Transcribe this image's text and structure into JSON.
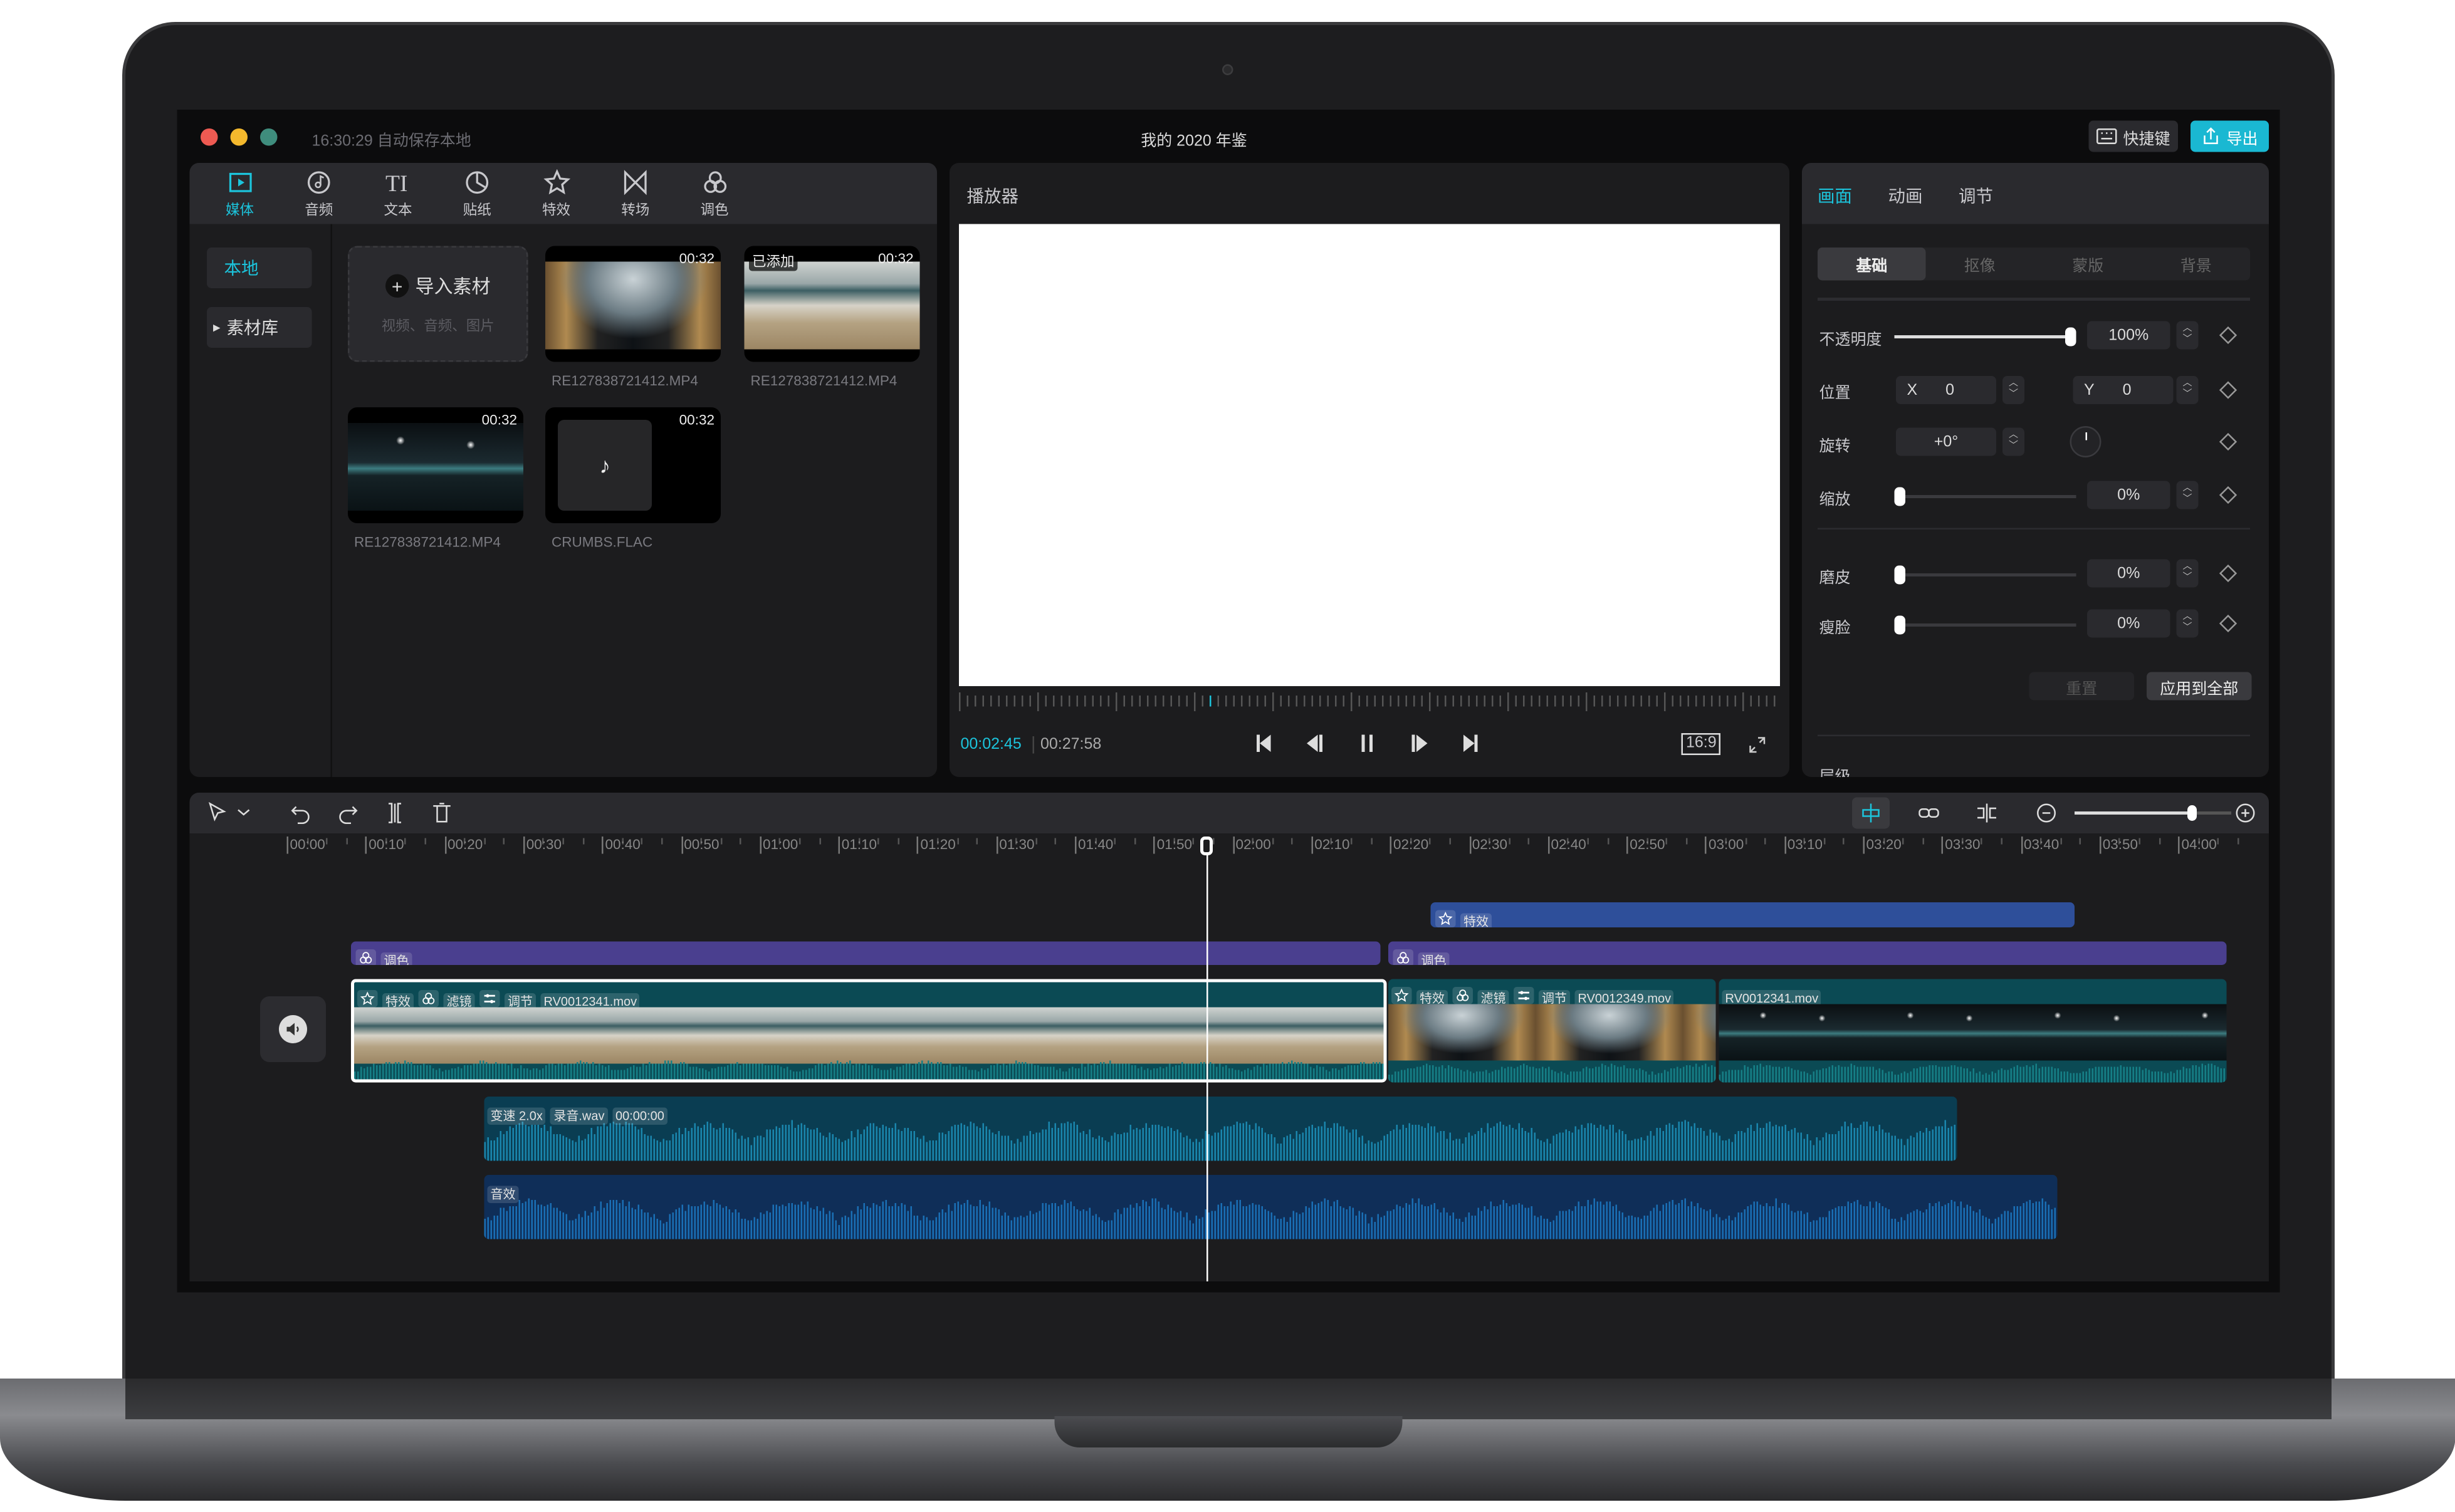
{
  "window": {
    "autosave": "16:30:29 自动保存本地",
    "title": "我的 2020 年鉴",
    "shortcut_label": "快捷键",
    "export_label": "导出",
    "accent": "#1cc4dc"
  },
  "media": {
    "tabs": [
      {
        "label": "媒体",
        "icon": "media-icon",
        "active": true
      },
      {
        "label": "音频",
        "icon": "audio-icon"
      },
      {
        "label": "文本",
        "icon": "text-icon"
      },
      {
        "label": "贴纸",
        "icon": "sticker-icon"
      },
      {
        "label": "特效",
        "icon": "effects-icon"
      },
      {
        "label": "转场",
        "icon": "transition-icon"
      },
      {
        "label": "调色",
        "icon": "color-icon"
      }
    ],
    "nav": [
      {
        "label": "本地",
        "active": true
      },
      {
        "label": "素材库"
      }
    ],
    "import": {
      "label": "导入素材",
      "hint": "视频、音频、图片"
    },
    "items": [
      {
        "name": "RE127838721412.MP4",
        "duration": "00:32",
        "kind": "tunnel"
      },
      {
        "name": "RE127838721412.MP4",
        "duration": "00:32",
        "kind": "desert",
        "badge": "已添加"
      },
      {
        "name": "RE127838721412.MP4",
        "duration": "00:32",
        "kind": "garage"
      },
      {
        "name": "CRUMBS.FLAC",
        "duration": "00:32",
        "kind": "audio"
      }
    ]
  },
  "player": {
    "title": "播放器",
    "current": "00:02:45",
    "total": "00:27:58",
    "ratio": "16:9"
  },
  "props": {
    "tabs": [
      {
        "label": "画面",
        "active": true
      },
      {
        "label": "动画"
      },
      {
        "label": "调节"
      }
    ],
    "subtabs": [
      {
        "label": "基础",
        "active": true
      },
      {
        "label": "抠像"
      },
      {
        "label": "蒙版"
      },
      {
        "label": "背景"
      }
    ],
    "opacity": {
      "label": "不透明度",
      "value": "100%",
      "level": 100
    },
    "position": {
      "label": "位置",
      "x_label": "X",
      "x": "0",
      "y_label": "Y",
      "y": "0"
    },
    "rotation": {
      "label": "旋转",
      "value": "+0°"
    },
    "scale": {
      "label": "缩放",
      "value": "0%",
      "level": 0
    },
    "smooth": {
      "label": "磨皮",
      "value": "0%",
      "level": 0
    },
    "slim": {
      "label": "瘦脸",
      "value": "0%",
      "level": 0
    },
    "reset_label": "重置",
    "apply_all_label": "应用到全部",
    "layer_label": "层级"
  },
  "timeline": {
    "ruler": [
      "00:00",
      "00:10",
      "00:20",
      "00:30",
      "00:40",
      "00:50",
      "01:00",
      "01:10",
      "01:20",
      "01:30",
      "01:40",
      "01:50",
      "02:00",
      "02:10",
      "02:20",
      "02:30",
      "02:40",
      "02:50",
      "03:00",
      "03:10",
      "03:20",
      "03:30",
      "03:40",
      "03:50",
      "04:00"
    ],
    "zoom_level": 75,
    "effect_clip": {
      "label": "特效"
    },
    "color_clips": [
      {
        "label": "调色"
      },
      {
        "label": "调色"
      }
    ],
    "video_clips": [
      {
        "chips": [
          "特效",
          "滤镜",
          "调节"
        ],
        "name": "RV0012341.mov",
        "kind": "desert",
        "selected": true
      },
      {
        "chips": [
          "特效",
          "滤镜",
          "调节"
        ],
        "name": "RV0012349.mov",
        "kind": "tunnel"
      },
      {
        "chips": [],
        "name": "RV0012341.mov",
        "kind": "garage"
      }
    ],
    "audio_clips": [
      {
        "chips": [
          "变速 2.0x",
          "录音.wav",
          "00:00:00"
        ],
        "color": "#0a3d52",
        "wave": "#1a86ad"
      },
      {
        "chips": [
          "音效"
        ],
        "color": "#0f2e58",
        "wave": "#1a6fb5"
      }
    ],
    "colors": {
      "effect": "#2e4f9a",
      "color": "#4a3f8f",
      "video": "#0b4a54"
    }
  }
}
